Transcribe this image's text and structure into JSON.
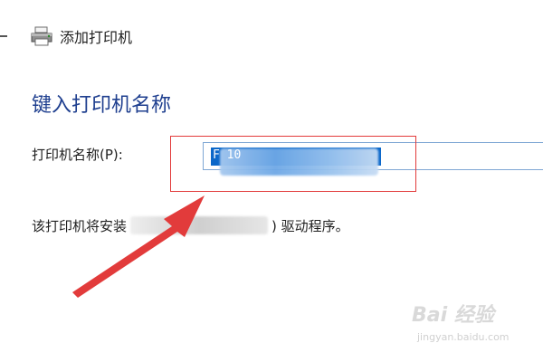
{
  "window": {
    "title": "添加打印机",
    "icon": "printer-icon"
  },
  "section": {
    "heading": "键入打印机名称"
  },
  "printer_name": {
    "label": "打印机名称(P):",
    "value": "F                               10",
    "selection_color": "#0b67c9"
  },
  "driver_note": {
    "prefix": "该打印机将安装",
    "suffix": ") 驱动程序。"
  },
  "annotation": {
    "box_color": "#e23b3b",
    "arrow_color": "#e23b3b"
  },
  "watermark": {
    "main": "Bai 经验",
    "sub": "jingyan.baidu.com"
  }
}
